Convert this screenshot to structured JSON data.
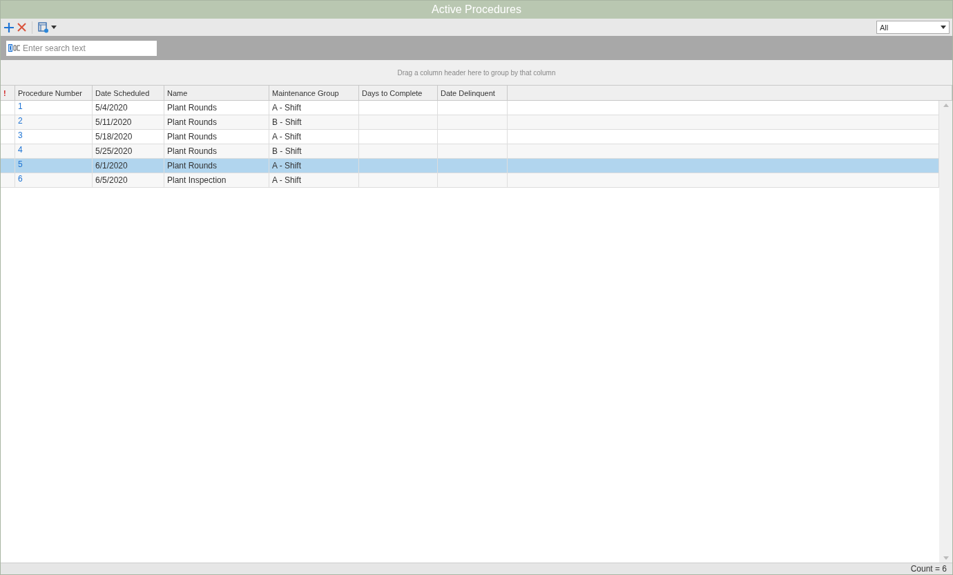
{
  "window": {
    "title": "Active Procedures"
  },
  "toolbar": {
    "filter": {
      "value": "All"
    }
  },
  "search": {
    "placeholder": "Enter search text"
  },
  "group_panel": {
    "hint": "Drag a column header here to group by that column"
  },
  "table": {
    "columns": [
      "!",
      "Procedure Number",
      "Date Scheduled",
      "Name",
      "Maintenance Group",
      "Days to Complete",
      "Date Delinquent"
    ],
    "rows": [
      {
        "cells": [
          "",
          "1",
          "5/4/2020",
          "Plant Rounds",
          "A - Shift",
          "",
          ""
        ],
        "selected": false
      },
      {
        "cells": [
          "",
          "2",
          "5/11/2020",
          "Plant Rounds",
          "B - Shift",
          "",
          ""
        ],
        "selected": false
      },
      {
        "cells": [
          "",
          "3",
          "5/18/2020",
          "Plant Rounds",
          "A - Shift",
          "",
          ""
        ],
        "selected": false
      },
      {
        "cells": [
          "",
          "4",
          "5/25/2020",
          "Plant Rounds",
          "B - Shift",
          "",
          ""
        ],
        "selected": false
      },
      {
        "cells": [
          "",
          "5",
          "6/1/2020",
          "Plant Rounds",
          "A - Shift",
          "",
          ""
        ],
        "selected": true
      },
      {
        "cells": [
          "",
          "6",
          "6/5/2020",
          "Plant Inspection",
          "A - Shift",
          "",
          ""
        ],
        "selected": false
      }
    ]
  },
  "status_bar": {
    "count": "Count = 6"
  }
}
